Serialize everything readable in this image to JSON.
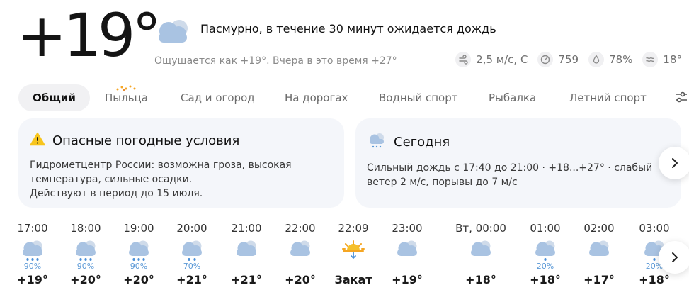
{
  "current": {
    "temperature": "+19°",
    "condition": "Пасмурно, в течение 30 минут ожидается дождь",
    "feels_like": "Ощущается как +19°. Вчера в это время +27°",
    "icon": "cloud-icon"
  },
  "metrics": [
    {
      "icon": "wind-icon",
      "value": "2,5 м/с, С"
    },
    {
      "icon": "pressure-icon",
      "value": "759"
    },
    {
      "icon": "humidity-icon",
      "value": "78%"
    },
    {
      "icon": "water-temp-icon",
      "value": "18°"
    }
  ],
  "tabs": [
    "Общий",
    "Пыльца",
    "Сад и огород",
    "На дорогах",
    "Водный спорт",
    "Рыбалка",
    "Летний спорт"
  ],
  "alert_card": {
    "title": "Опасные погодные условия",
    "lines": [
      "Гидрометцентр России: возможна гроза, высокая",
      "температура, сильные осадки.",
      "Действуют в период до 15 июля."
    ],
    "icon": "warning-icon"
  },
  "today_card": {
    "title": "Сегодня",
    "lines": [
      "Сильный дождь с 17:40 до 21:00 · +18...+27° · слабый",
      "ветер 2 м/с, порывы до 7 м/с"
    ],
    "icon": "rain-cloud-icon"
  },
  "hourly": [
    {
      "time": "17:00",
      "icon": "rain-heavy",
      "prob": "90%",
      "temp": "+19°"
    },
    {
      "time": "18:00",
      "icon": "rain-heavy",
      "prob": "90%",
      "temp": "+20°"
    },
    {
      "time": "19:00",
      "icon": "rain-heavy",
      "prob": "90%",
      "temp": "+20°"
    },
    {
      "time": "20:00",
      "icon": "rain-medium",
      "prob": "70%",
      "temp": "+21°"
    },
    {
      "time": "21:00",
      "icon": "cloud",
      "prob": "",
      "temp": "+21°"
    },
    {
      "time": "22:00",
      "icon": "cloud",
      "prob": "",
      "temp": "+20°"
    },
    {
      "time": "22:09",
      "icon": "sunset",
      "prob": "",
      "temp": "Закат"
    },
    {
      "time": "23:00",
      "icon": "cloud",
      "prob": "",
      "temp": "+19°"
    },
    {
      "time": "Вт, 00:00",
      "icon": "cloud",
      "prob": "",
      "temp": "+18°"
    },
    {
      "time": "01:00",
      "icon": "rain-light",
      "prob": "20%",
      "temp": "+18°"
    },
    {
      "time": "02:00",
      "icon": "cloud",
      "prob": "",
      "temp": "+17°"
    },
    {
      "time": "03:00",
      "icon": "rain-light",
      "prob": "20%",
      "temp": "+18°"
    }
  ],
  "colors": {
    "accent_blue": "#5a98d6",
    "warning_yellow": "#f7c51d",
    "card_bg": "#f4f6fa",
    "sun_orange": "#f5a623"
  }
}
